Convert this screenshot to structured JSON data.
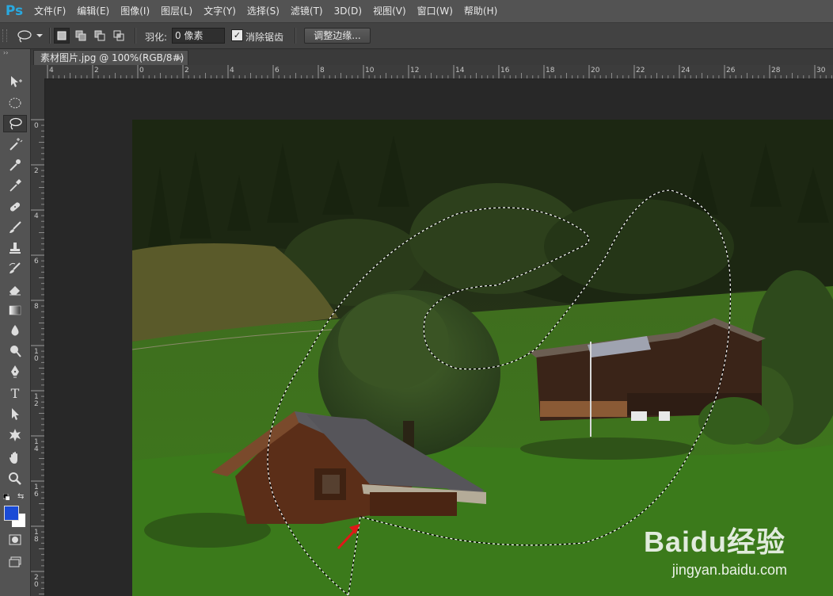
{
  "app": {
    "logo": "Ps",
    "brand_color": "#29a9e0"
  },
  "menu": [
    "文件(F)",
    "编辑(E)",
    "图像(I)",
    "图层(L)",
    "文字(Y)",
    "选择(S)",
    "滤镜(T)",
    "3D(D)",
    "视图(V)",
    "窗口(W)",
    "帮助(H)"
  ],
  "options": {
    "tool_icon": "lasso-icon",
    "feather_label": "羽化:",
    "feather_value": "0 像素",
    "antialias_checked": true,
    "antialias_label": "消除锯齿",
    "refine_edge_label": "调整边缘..."
  },
  "document": {
    "tab_title": "素材图片.jpg @ 100%(RGB/8#)",
    "close_symbol": "×"
  },
  "ruler": {
    "top_labels": [
      "4",
      "2",
      "0",
      "2",
      "4",
      "6",
      "8",
      "10",
      "12",
      "14",
      "16",
      "18",
      "20",
      "22",
      "24",
      "26",
      "28",
      "30"
    ],
    "left_labels": [
      "0",
      "2",
      "4",
      "6",
      "8",
      "10",
      "12",
      "14",
      "16",
      "18",
      "20"
    ]
  },
  "colors": {
    "foreground": "#1a4bd6",
    "background": "#ffffff"
  },
  "toolbar": {
    "tools": [
      "move-icon",
      "ellipse-marquee-icon",
      "lasso-icon",
      "magic-wand-icon",
      "eyedropper-icon",
      "eyedropper-icon",
      "healing-brush-icon",
      "brush-icon",
      "stamp-icon",
      "history-brush-icon",
      "eraser-icon",
      "gradient-icon",
      "blur-icon",
      "dodge-icon",
      "pen-icon",
      "type-icon",
      "path-select-icon",
      "custom-shape-icon",
      "hand-icon",
      "zoom-icon"
    ],
    "type_tool_glyph": "T"
  },
  "watermark": {
    "logo": "Baidu经验",
    "url": "jingyan.baidu.com"
  }
}
